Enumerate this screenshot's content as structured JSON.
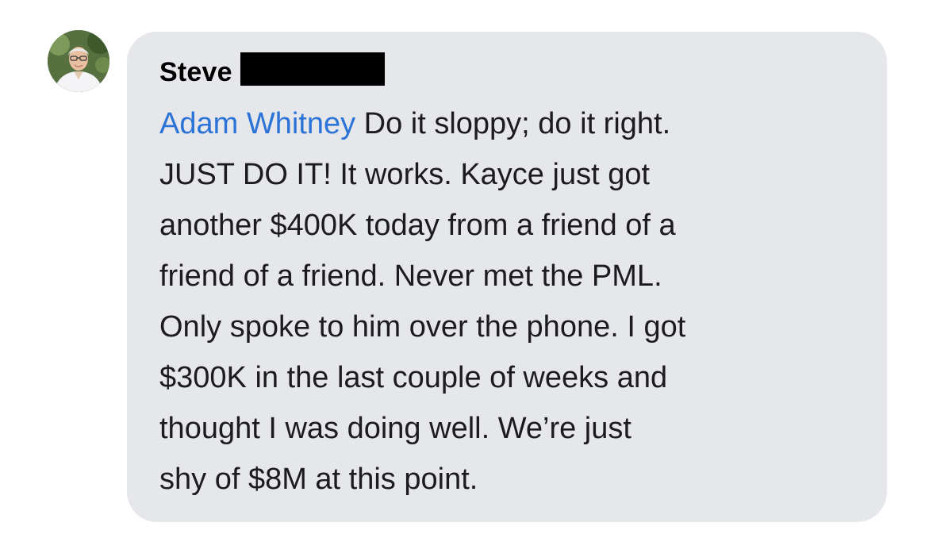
{
  "comment": {
    "author": "Steve",
    "mention": "Adam Whitney",
    "message_lines": [
      " Do it sloppy; do it right.",
      "JUST DO IT!  It works. Kayce just got",
      "another $400K today from a friend of a",
      "friend of a friend. Never met the PML.",
      "Only spoke to him over the phone. I got",
      "$300K in the last couple of weeks and",
      "thought I was doing well. We’re just",
      "shy of $8M at this point."
    ]
  },
  "colors": {
    "bubble_background": "#e5e7ea",
    "mention_link": "#2b73d6",
    "text": "#1c1c1e"
  }
}
